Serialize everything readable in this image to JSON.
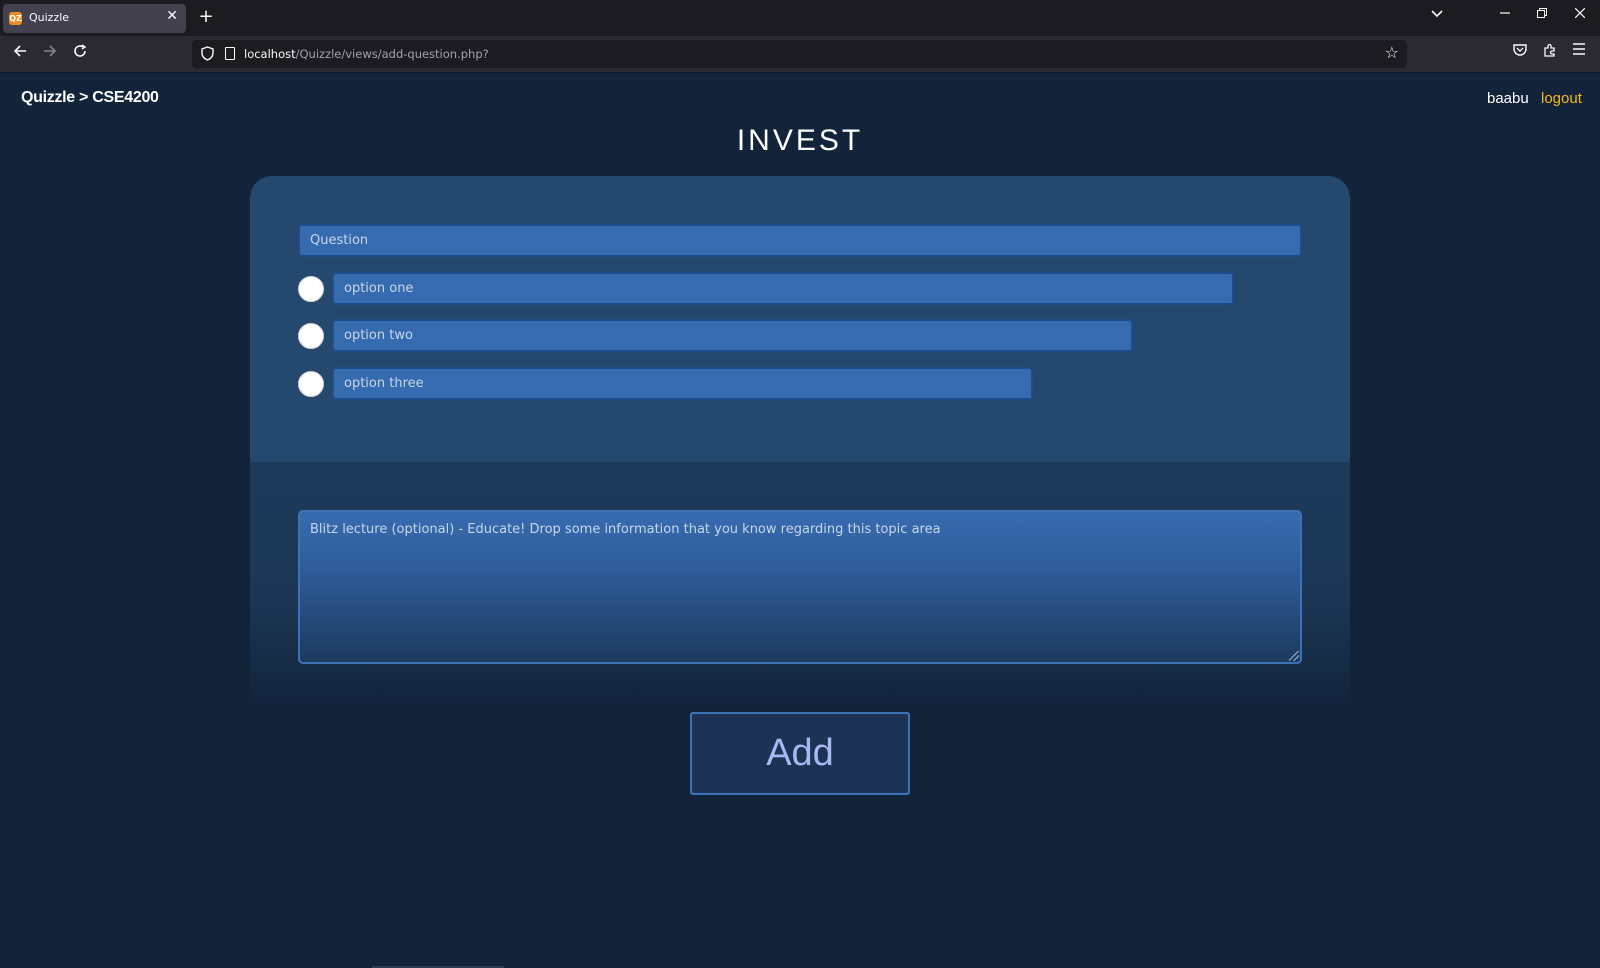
{
  "browser": {
    "tab_title": "Quizzle",
    "tab_favicon": "QZ",
    "new_tab_glyph": "+",
    "tab_close_glyph": "✕",
    "url_host": "localhost",
    "url_path": "/Quizzle/views/add-question.php?",
    "icons": [
      "back-icon",
      "forward-icon",
      "reload-icon",
      "shield-icon",
      "page-icon",
      "bookmark-star-icon",
      "pocket-icon",
      "extensions-icon",
      "menu-icon",
      "tab-list-icon",
      "minimize-icon",
      "restore-icon",
      "close-window-icon"
    ]
  },
  "header": {
    "breadcrumb": "Quizzle > CSE4200",
    "username": "baabu",
    "logout": "logout"
  },
  "page": {
    "title": "INVEST"
  },
  "form": {
    "question_placeholder": "Question",
    "options": [
      {
        "placeholder": "option one"
      },
      {
        "placeholder": "option two"
      },
      {
        "placeholder": "option three"
      }
    ],
    "lecture_placeholder": "Blitz lecture (optional) - Educate! Drop some information that you know regarding this topic area",
    "submit_label": "Add"
  },
  "colors": {
    "page_background": "#12233a",
    "card_background": "#25496e",
    "input_background": "#376bb0",
    "logout_link": "#f5b818",
    "button_text": "#a9b7f3"
  }
}
